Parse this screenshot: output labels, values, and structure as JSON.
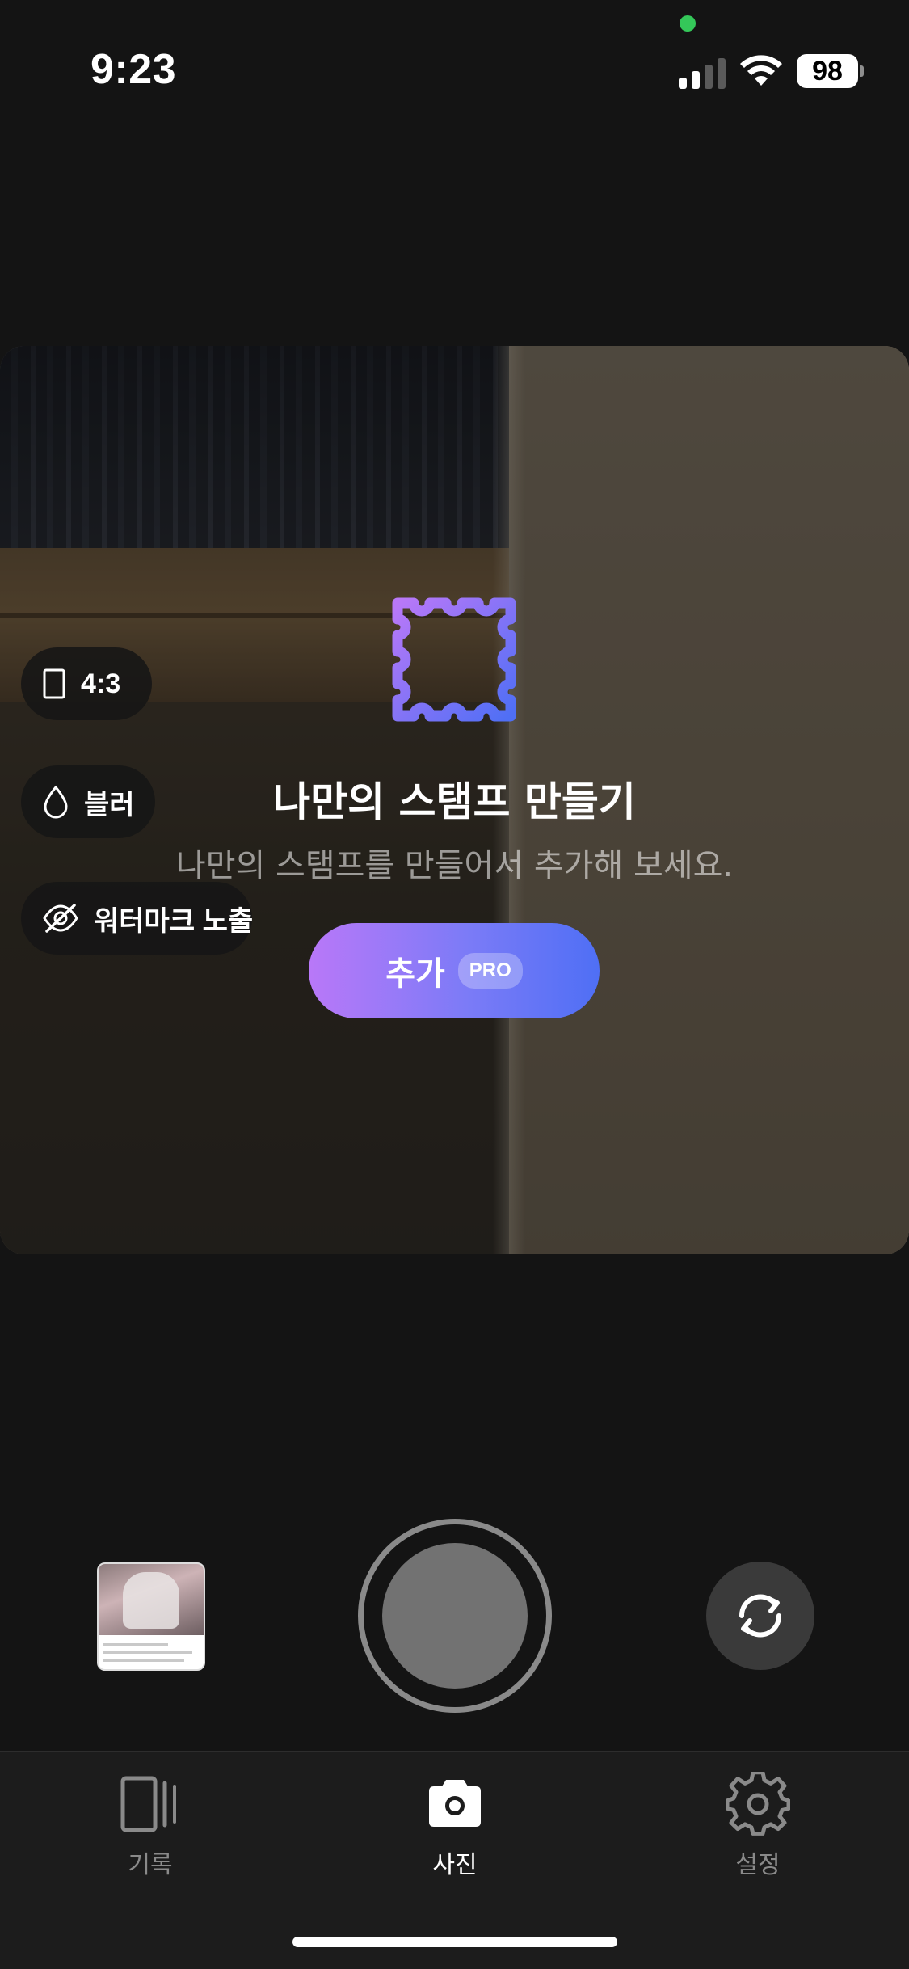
{
  "status_bar": {
    "time": "9:23",
    "battery": "98",
    "privacy_dot_color": "#34c759"
  },
  "preview_controls": {
    "ratio_label": "4:3",
    "blur_label": "블러",
    "watermark_label": "워터마크 노출"
  },
  "stamp_promo": {
    "title": "나만의 스탬프 만들기",
    "subtitle": "나만의 스탬프를 만들어서 추가해 보세요.",
    "add_button_label": "추가",
    "pro_badge": "PRO",
    "gradient_start": "#b978f8",
    "gradient_end": "#4f6ff5"
  },
  "capture": {
    "thumbnail_icon": "recent-photo-thumbnail",
    "shutter_icon": "shutter",
    "flip_icon": "flip-camera-icon"
  },
  "tabs": [
    {
      "label": "기록",
      "icon": "history-cards-icon",
      "active": false
    },
    {
      "label": "사진",
      "icon": "camera-icon",
      "active": true
    },
    {
      "label": "설정",
      "icon": "gear-icon",
      "active": false
    }
  ]
}
